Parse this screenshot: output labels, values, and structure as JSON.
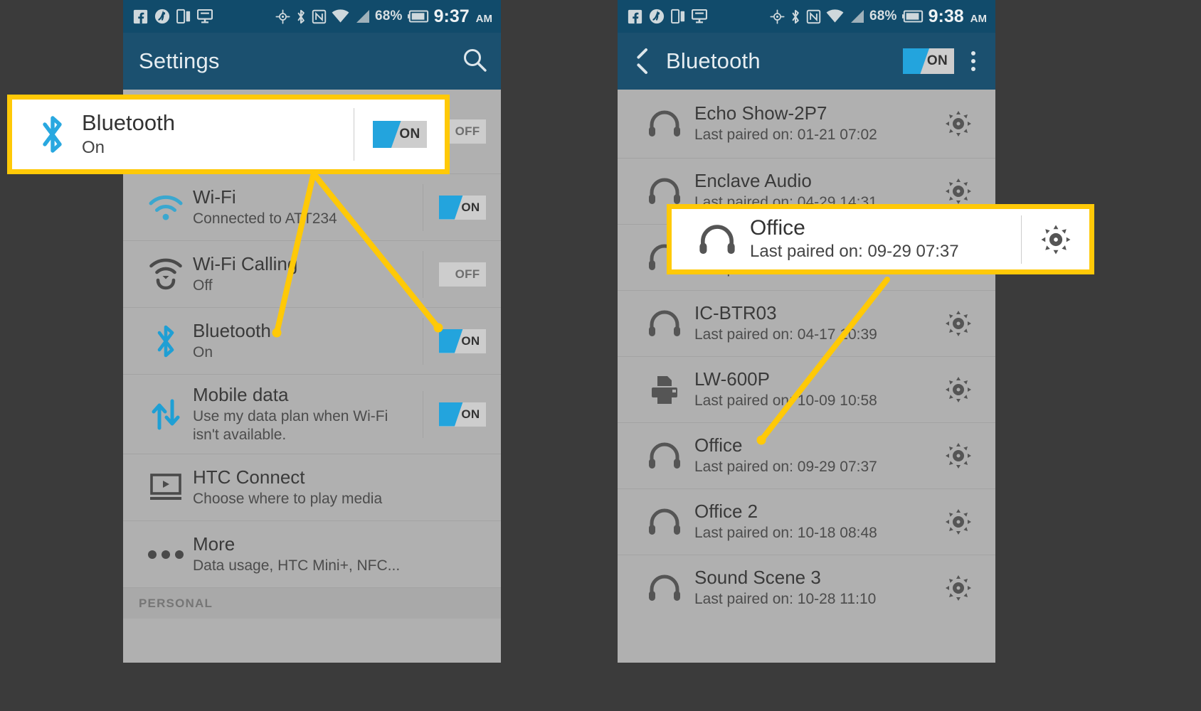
{
  "statusbar": {
    "battery_percent": "68%",
    "left_icons": [
      "facebook-icon",
      "fitness-icon",
      "dual-window-icon",
      "message-icon"
    ],
    "right_icons": [
      "gps-icon",
      "bluetooth-icon",
      "nfc-icon",
      "wifi-icon",
      "signal-icon"
    ],
    "left_time": "9:37",
    "right_time": "9:38",
    "ampm": "AM"
  },
  "left_phone": {
    "appbar": {
      "title": "Settings",
      "search_icon": "search-icon"
    },
    "rows": [
      {
        "title": "Wi-Fi",
        "subtitle": "Connected to ATT234",
        "icon": "wifi-icon",
        "toggle": "ON",
        "toggle_state": "on"
      },
      {
        "title": "Wi-Fi Calling",
        "subtitle": "Off",
        "icon": "wifi-calling-icon",
        "toggle": "OFF",
        "toggle_state": "off"
      },
      {
        "title": "Bluetooth",
        "subtitle": "On",
        "icon": "bluetooth-icon",
        "toggle": "ON",
        "toggle_state": "on"
      },
      {
        "title": "Mobile data",
        "subtitle": "Use my data plan when Wi-Fi isn't available.",
        "icon": "mobile-data-icon",
        "toggle": "ON",
        "toggle_state": "on"
      },
      {
        "title": "HTC Connect",
        "subtitle": "Choose where to play media",
        "icon": "htc-connect-icon",
        "toggle": "",
        "toggle_state": "none"
      },
      {
        "title": "More",
        "subtitle": "Data usage, HTC Mini+, NFC...",
        "icon": "more-dots-icon",
        "toggle": "",
        "toggle_state": "none"
      }
    ],
    "partial_top_row_toggle": "OFF",
    "section_header": "PERSONAL"
  },
  "right_phone": {
    "appbar": {
      "title": "Bluetooth",
      "back_icon": "back-chevron-icon",
      "toggle": "ON",
      "overflow_icon": "kebab-menu-icon"
    },
    "devices": [
      {
        "name": "Echo Show-2P7",
        "paired": "Last paired on: 01-21 07:02",
        "icon": "headphones-icon",
        "action": "gear-icon"
      },
      {
        "name": "Enclave Audio",
        "paired": "Last paired on: 04-29 14:31",
        "icon": "headphones-icon",
        "action": "gear-icon"
      },
      {
        "name": "Office",
        "paired": "Last paired on: 09-29 07:37",
        "icon": "headphones-icon",
        "action": "gear-icon"
      },
      {
        "name": "IC-BTR03",
        "paired": "Last paired on: 04-17 10:39",
        "icon": "headphones-icon",
        "action": "gear-icon"
      },
      {
        "name": "LW-600P",
        "paired": "Last paired on: 10-09 10:58",
        "icon": "printer-icon",
        "action": "gear-icon"
      },
      {
        "name": "Office",
        "paired": "Last paired on: 09-29 07:37",
        "icon": "headphones-icon",
        "action": "gear-icon"
      },
      {
        "name": "Office 2",
        "paired": "Last paired on: 10-18 08:48",
        "icon": "headphones-icon",
        "action": "gear-icon"
      },
      {
        "name": "Sound Scene 3",
        "paired": "Last paired on: 10-28 11:10",
        "icon": "headphones-icon",
        "action": "gear-icon"
      }
    ]
  },
  "callouts": {
    "bluetooth": {
      "title": "Bluetooth",
      "subtitle": "On",
      "toggle": "ON",
      "icon": "bluetooth-icon"
    },
    "office": {
      "title": "Office",
      "subtitle": "Last paired on: 09-29 07:37",
      "icon": "headphones-icon",
      "action": "gear-icon"
    }
  },
  "navbar": {
    "back": "back-arrow-icon",
    "home": "home-icon",
    "recents": "recents-icon"
  },
  "colors": {
    "highlight": "#ffc907",
    "appbar": "#1b506f",
    "statusbar": "#114b6b",
    "accent_blue": "#29a8e0",
    "list_bg": "#b0b0b0"
  }
}
